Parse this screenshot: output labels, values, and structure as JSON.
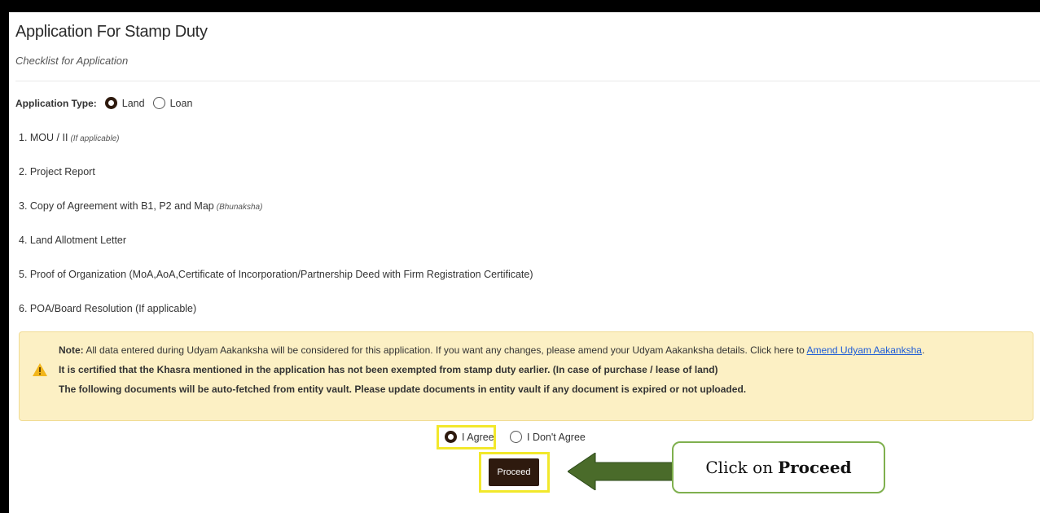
{
  "header": {
    "title": "Application For Stamp Duty",
    "subtitle": "Checklist for Application"
  },
  "application_type": {
    "label": "Application Type:",
    "options": [
      "Land",
      "Loan"
    ],
    "selected": "Land"
  },
  "checklist": [
    {
      "text": "1. MOU / II",
      "hint": "(If applicable)"
    },
    {
      "text": "2. Project Report",
      "hint": ""
    },
    {
      "text": "3. Copy of Agreement with B1, P2 and Map",
      "hint": "(Bhunaksha)"
    },
    {
      "text": "4. Land Allotment Letter",
      "hint": ""
    },
    {
      "text": "5. Proof of Organization (MoA,AoA,Certificate of Incorporation/Partnership Deed with Firm Registration Certificate)",
      "hint": ""
    },
    {
      "text": "6. POA/Board Resolution (If applicable)",
      "hint": ""
    }
  ],
  "note": {
    "label": "Note:",
    "text": "All data entered during Udyam Aakanksha will be considered for this application. If you want any changes, please amend your Udyam Aakanksha details. Click here to",
    "link": "Amend Udyam Aakanksha",
    "link_suffix": ".",
    "certified": "It is certified that the Khasra mentioned in the application has not been exempted from stamp duty earlier. (In case of purchase / lease of land)",
    "autofetch": "The following documents will be auto-fetched from entity vault. Please update documents in entity vault if any document is expired or not uploaded.",
    "icon": "warning-icon",
    "bg_color": "#fcf0c4"
  },
  "agreement": {
    "options": [
      "I Agree",
      "I Don't Agree"
    ],
    "selected": "I Agree"
  },
  "proceed_button": {
    "label": "Proceed",
    "color": "#2e1a0e"
  },
  "annotation": {
    "prefix": "Click on",
    "emphasis": "Proceed",
    "highlight_color": "#f2e82b",
    "arrow_color": "#4a6b2a"
  }
}
